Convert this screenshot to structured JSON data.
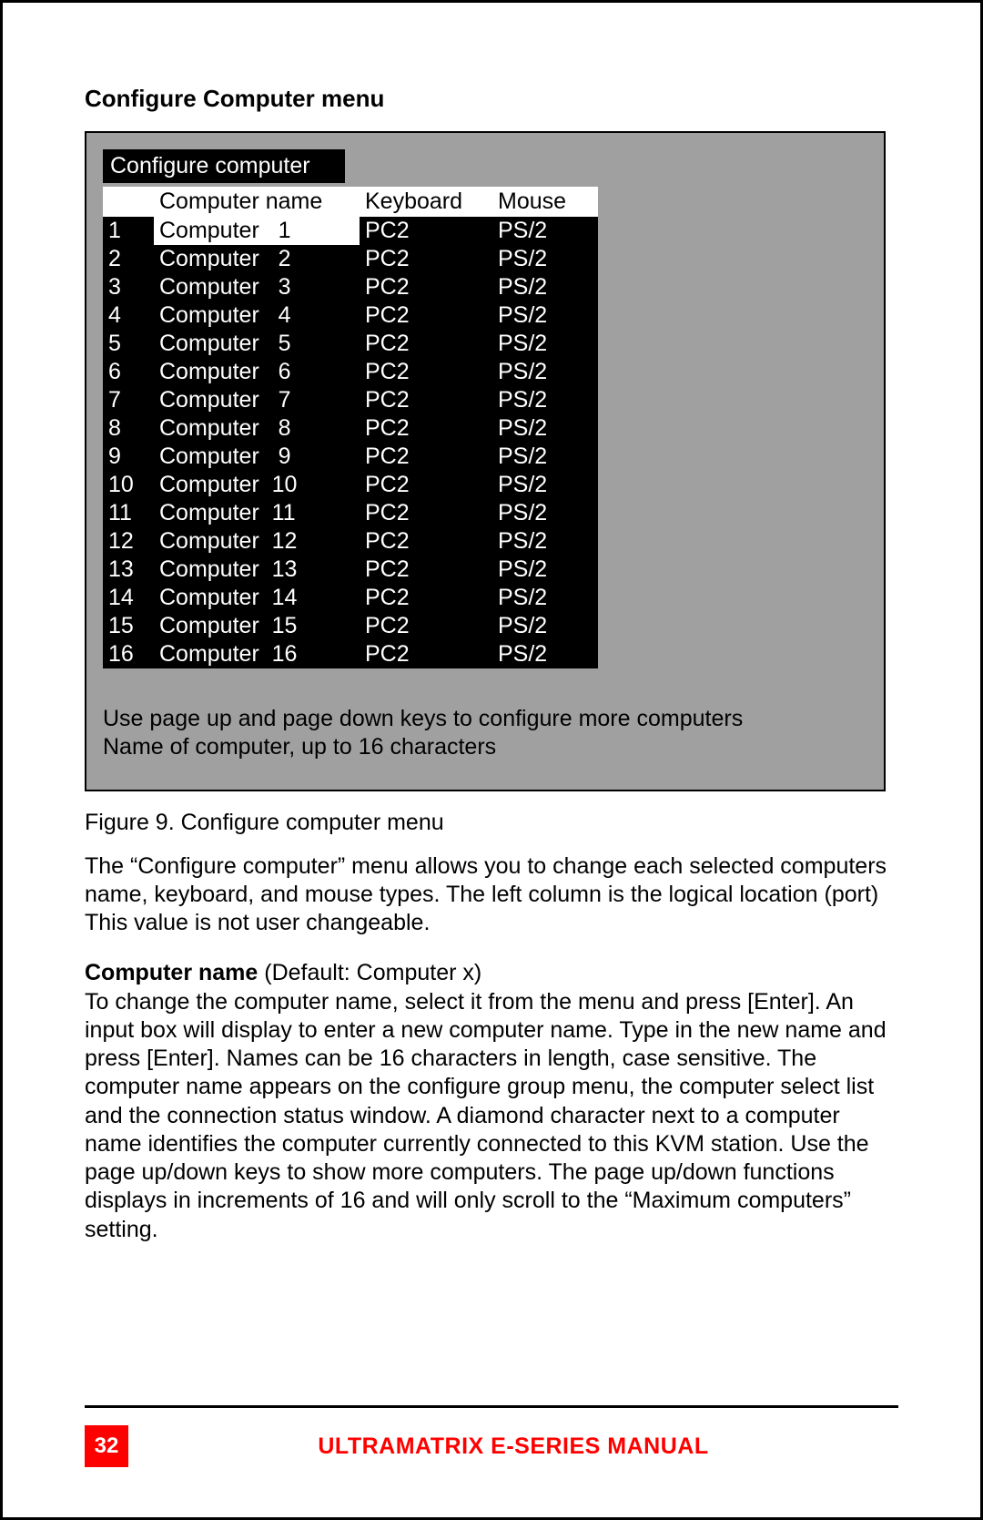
{
  "section_title": "Configure Computer menu",
  "menu": {
    "title": "Configure computer",
    "headers": {
      "name": "Computer name",
      "keyboard": "Keyboard",
      "mouse": "Mouse"
    },
    "rows": [
      {
        "idx": "1",
        "name": "Computer   1",
        "kb": "PC2",
        "mouse": "PS/2",
        "selected": true
      },
      {
        "idx": "2",
        "name": "Computer   2",
        "kb": "PC2",
        "mouse": "PS/2",
        "selected": false
      },
      {
        "idx": "3",
        "name": "Computer   3",
        "kb": "PC2",
        "mouse": "PS/2",
        "selected": false
      },
      {
        "idx": "4",
        "name": "Computer   4",
        "kb": "PC2",
        "mouse": "PS/2",
        "selected": false
      },
      {
        "idx": "5",
        "name": "Computer   5",
        "kb": "PC2",
        "mouse": "PS/2",
        "selected": false
      },
      {
        "idx": "6",
        "name": "Computer   6",
        "kb": "PC2",
        "mouse": "PS/2",
        "selected": false
      },
      {
        "idx": "7",
        "name": "Computer   7",
        "kb": "PC2",
        "mouse": "PS/2",
        "selected": false
      },
      {
        "idx": "8",
        "name": "Computer   8",
        "kb": "PC2",
        "mouse": "PS/2",
        "selected": false
      },
      {
        "idx": "9",
        "name": "Computer   9",
        "kb": "PC2",
        "mouse": "PS/2",
        "selected": false
      },
      {
        "idx": "10",
        "name": "Computer  10",
        "kb": "PC2",
        "mouse": "PS/2",
        "selected": false
      },
      {
        "idx": "11",
        "name": "Computer  11",
        "kb": "PC2",
        "mouse": "PS/2",
        "selected": false
      },
      {
        "idx": "12",
        "name": "Computer  12",
        "kb": "PC2",
        "mouse": "PS/2",
        "selected": false
      },
      {
        "idx": "13",
        "name": "Computer  13",
        "kb": "PC2",
        "mouse": "PS/2",
        "selected": false
      },
      {
        "idx": "14",
        "name": "Computer  14",
        "kb": "PC2",
        "mouse": "PS/2",
        "selected": false
      },
      {
        "idx": "15",
        "name": "Computer  15",
        "kb": "PC2",
        "mouse": "PS/2",
        "selected": false
      },
      {
        "idx": "16",
        "name": "Computer  16",
        "kb": "PC2",
        "mouse": "PS/2",
        "selected": false
      }
    ],
    "hint_line1": "Use page up and page down keys to configure more computers",
    "hint_line2": "Name of computer, up to 16 characters"
  },
  "figure_caption": "Figure 9. Configure computer menu",
  "para1": "The “Configure computer” menu allows you to change each selected computers name, keyboard, and mouse types.  The left column is the logical location (port)  This value is not user changeable.",
  "para2_label": "Computer name",
  "para2_default": " (Default: Computer    x)",
  "para2_body": "To change the computer name, select it from the menu and press [Enter].  An input box will display to enter a new computer name.  Type in the new name and press [Enter].  Names can be 16 characters in length, case sensitive.  The computer name appears on the configure group menu, the computer select list and the connection status window.  A diamond character next to a computer name identifies the computer currently connected to this KVM station.  Use the page up/down keys to show more computers.  The page up/down functions displays in increments of 16 and will only scroll to the “Maximum computers” setting.",
  "footer": {
    "page_number": "32",
    "title": "ULTRAMATRIX E-SERIES MANUAL"
  }
}
